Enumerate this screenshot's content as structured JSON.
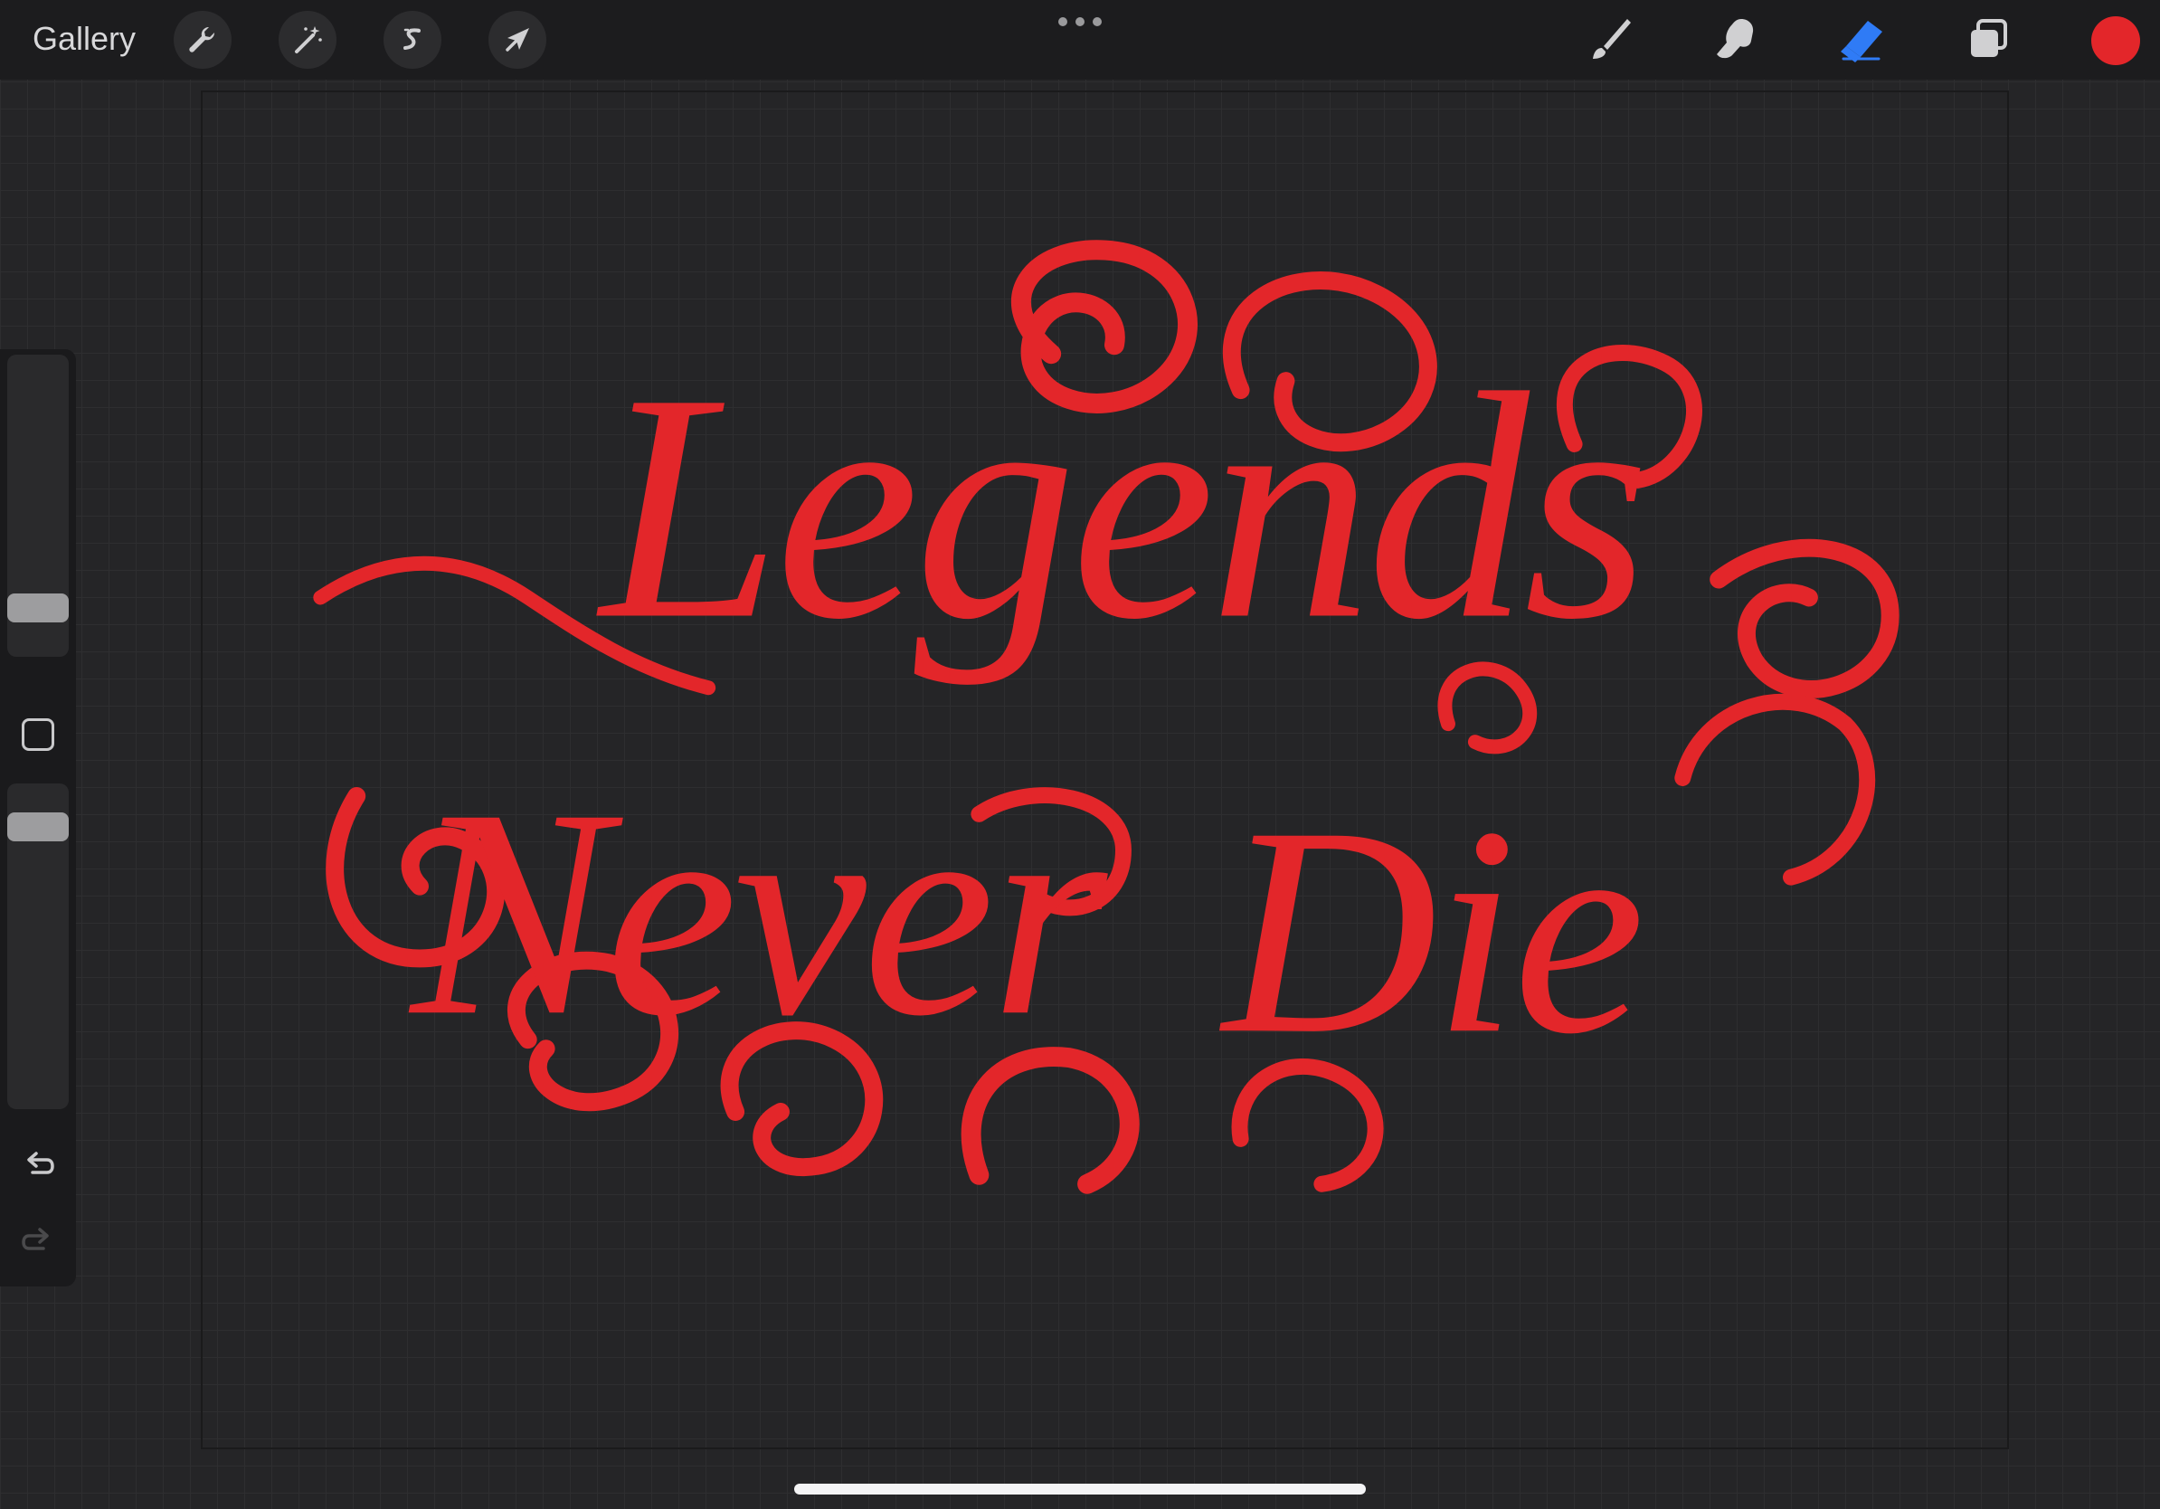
{
  "topbar": {
    "gallery_label": "Gallery",
    "actions": [
      {
        "name": "actions-wrench",
        "icon": "wrench-icon"
      },
      {
        "name": "adjustments",
        "icon": "magic-wand-icon"
      },
      {
        "name": "selection",
        "icon": "selection-s-icon"
      },
      {
        "name": "transform",
        "icon": "arrow-cursor-icon"
      }
    ],
    "more_icon": "ellipsis-icon",
    "tools": [
      {
        "name": "brush",
        "icon": "brush-icon",
        "active": false
      },
      {
        "name": "smudge",
        "icon": "smudge-finger-icon",
        "active": false
      },
      {
        "name": "eraser",
        "icon": "eraser-icon",
        "active": true
      },
      {
        "name": "layers",
        "icon": "layers-icon",
        "active": false
      }
    ],
    "current_color": "#e3262a"
  },
  "canvas": {
    "artwork_text": "Legends Never Die",
    "ink_color": "#e3262a",
    "background_color": "#252527"
  },
  "sidebar": {
    "brush_size_level": 0.83,
    "opacity_level": 0.82,
    "modifier_icon": "square-modifier-icon",
    "undo_icon": "undo-icon",
    "redo_icon": "redo-icon",
    "redo_enabled": false
  },
  "colors": {
    "accent_blue": "#2f7bf6",
    "icon_gray": "#d0d0d2",
    "bar_bg": "#1c1c1e"
  }
}
